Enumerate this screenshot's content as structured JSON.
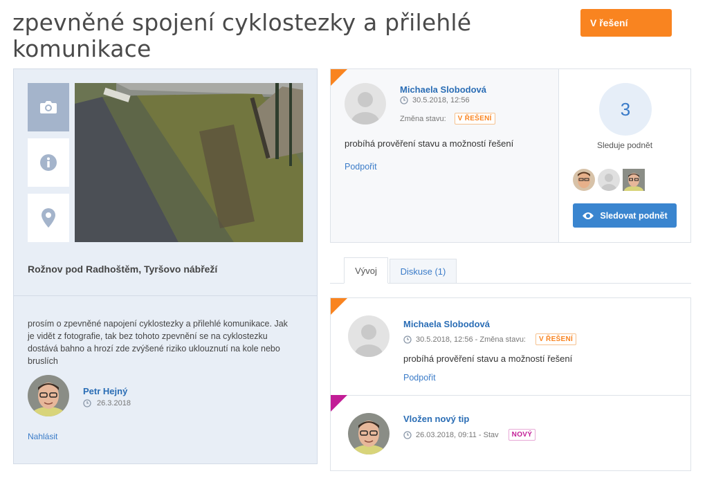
{
  "page": {
    "title": "zpevněné spojení cyklostezky a přilehlé komunikace",
    "status_button": "V řešení"
  },
  "tip": {
    "location": "Rožnov pod Radhoštěm, Tyršovo nábřeží",
    "description": "prosím o zpevněné napojení cyklostezky a přilehlé komunikace. Jak je vidět z fotografie, tak bez tohoto zpevnění se na cyklostezku dostává bahno a hrozí zde zvýšené riziko uklouznutí na kole nebo bruslích",
    "author": {
      "name": "Petr Hejný",
      "date": "26.3.2018"
    },
    "report_label": "Nahlásit",
    "side_tabs": [
      "camera-icon",
      "info-icon",
      "map-pin-icon"
    ]
  },
  "latest_status": {
    "user": "Michaela Slobodová",
    "datetime": "30.5.2018, 12:56",
    "change_label": "Změna stavu:",
    "badge": "V ŘEŠENÍ",
    "message": "probíhá prověření stavu a možností řešení",
    "support_label": "Podpořit"
  },
  "follow": {
    "count": "3",
    "label": "Sleduje podnět",
    "button_label": "Sledovat podnět"
  },
  "tabs": [
    {
      "label": "Vývoj"
    },
    {
      "label": "Diskuse (1)"
    }
  ],
  "timeline": [
    {
      "user": "Michaela Slobodová",
      "meta": "30.5.2018, 12:56 - Změna stavu:",
      "badge": "V ŘEŠENÍ",
      "message": "probíhá prověření stavu a možností řešení",
      "support_label": "Podpořit"
    },
    {
      "user": "Vložen nový tip",
      "meta": "26.03.2018, 09:11 - Stav",
      "badge": "NOVÝ"
    }
  ],
  "colors": {
    "accent_orange": "#f98420",
    "accent_pink": "#c21d96",
    "link_blue": "#2a6db5",
    "button_blue": "#3a85cf"
  }
}
